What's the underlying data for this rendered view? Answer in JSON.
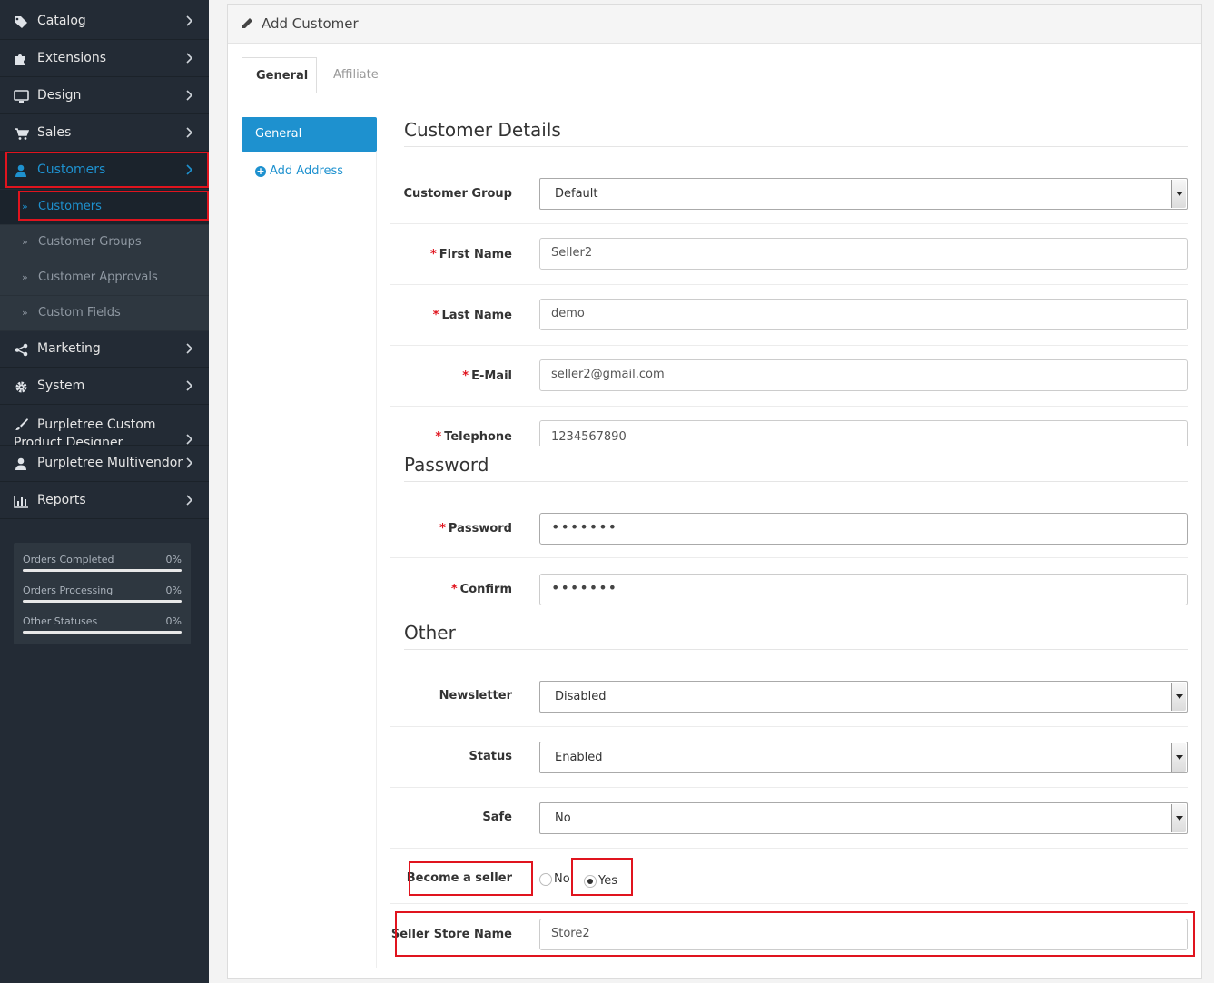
{
  "sidebar": {
    "menu": [
      {
        "label": "Catalog",
        "icon": "tags-icon"
      },
      {
        "label": "Extensions",
        "icon": "puzzle-icon"
      },
      {
        "label": "Design",
        "icon": "monitor-icon"
      },
      {
        "label": "Sales",
        "icon": "cart-icon"
      },
      {
        "label": "Customers",
        "icon": "user-icon"
      },
      {
        "label": "Marketing",
        "icon": "share-icon"
      },
      {
        "label": "System",
        "icon": "gear-icon"
      },
      {
        "label": "Purpletree Custom Product Designer",
        "icon": "brush-icon"
      },
      {
        "label": "Purpletree Multivendor",
        "icon": "user-icon"
      },
      {
        "label": "Reports",
        "icon": "bar-chart-icon"
      }
    ],
    "submenu": [
      {
        "label": "Customers"
      },
      {
        "label": "Customer Groups"
      },
      {
        "label": "Customer Approvals"
      },
      {
        "label": "Custom Fields"
      }
    ],
    "stats": [
      {
        "label": "Orders Completed",
        "value": "0%"
      },
      {
        "label": "Orders Processing",
        "value": "0%"
      },
      {
        "label": "Other Statuses",
        "value": "0%"
      }
    ],
    "accent_color": "#1e91cf"
  },
  "panel": {
    "title": "Add Customer",
    "tabs": [
      {
        "label": "General"
      },
      {
        "label": "Affiliate"
      }
    ],
    "vnav": {
      "active": "General",
      "add_address": "Add Address"
    }
  },
  "sections": {
    "customer_details": "Customer Details",
    "password": "Password",
    "other": "Other"
  },
  "fields": {
    "customer_group": {
      "label": "Customer Group",
      "value": "Default"
    },
    "first_name": {
      "label": "First Name",
      "value": "Seller2"
    },
    "last_name": {
      "label": "Last Name",
      "value": "demo"
    },
    "email": {
      "label": "E-Mail",
      "value": "seller2@gmail.com"
    },
    "telephone": {
      "label": "Telephone",
      "value": "1234567890"
    },
    "password": {
      "label": "Password",
      "value": "•••••••"
    },
    "confirm": {
      "label": "Confirm",
      "value": "•••••••"
    },
    "newsletter": {
      "label": "Newsletter",
      "value": "Disabled"
    },
    "status": {
      "label": "Status",
      "value": "Enabled"
    },
    "safe": {
      "label": "Safe",
      "value": "No"
    },
    "become_seller": {
      "label": "Become a seller",
      "option_no": "No",
      "option_yes": "Yes",
      "selected": "Yes"
    },
    "store_name": {
      "label": "Seller Store Name",
      "value": "Store2"
    },
    "required_marker": "*"
  }
}
